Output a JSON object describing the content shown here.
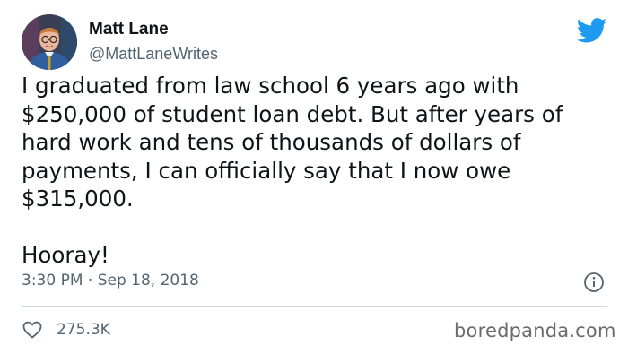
{
  "author": {
    "name": "Matt Lane",
    "handle": "@MattLaneWrites",
    "avatar_icon": "profile-photo"
  },
  "tweet": {
    "paragraphs": [
      "I graduated from law school 6 years ago with $250,000 of student loan debt. But after years of hard work and tens of thousands of dollars of payments, I can officially say that I now owe $315,000.",
      "Hooray!"
    ],
    "timestamp": "3:30 PM · Sep 18, 2018"
  },
  "engagement": {
    "likes": "275.3K"
  },
  "watermark": "boredpanda.com",
  "colors": {
    "twitter_blue": "#1d9bf0",
    "secondary_text": "#536471",
    "divider": "#cfd9de"
  },
  "icons": {
    "brand": "twitter-bird-icon",
    "info": "info-icon",
    "like": "heart-icon"
  }
}
